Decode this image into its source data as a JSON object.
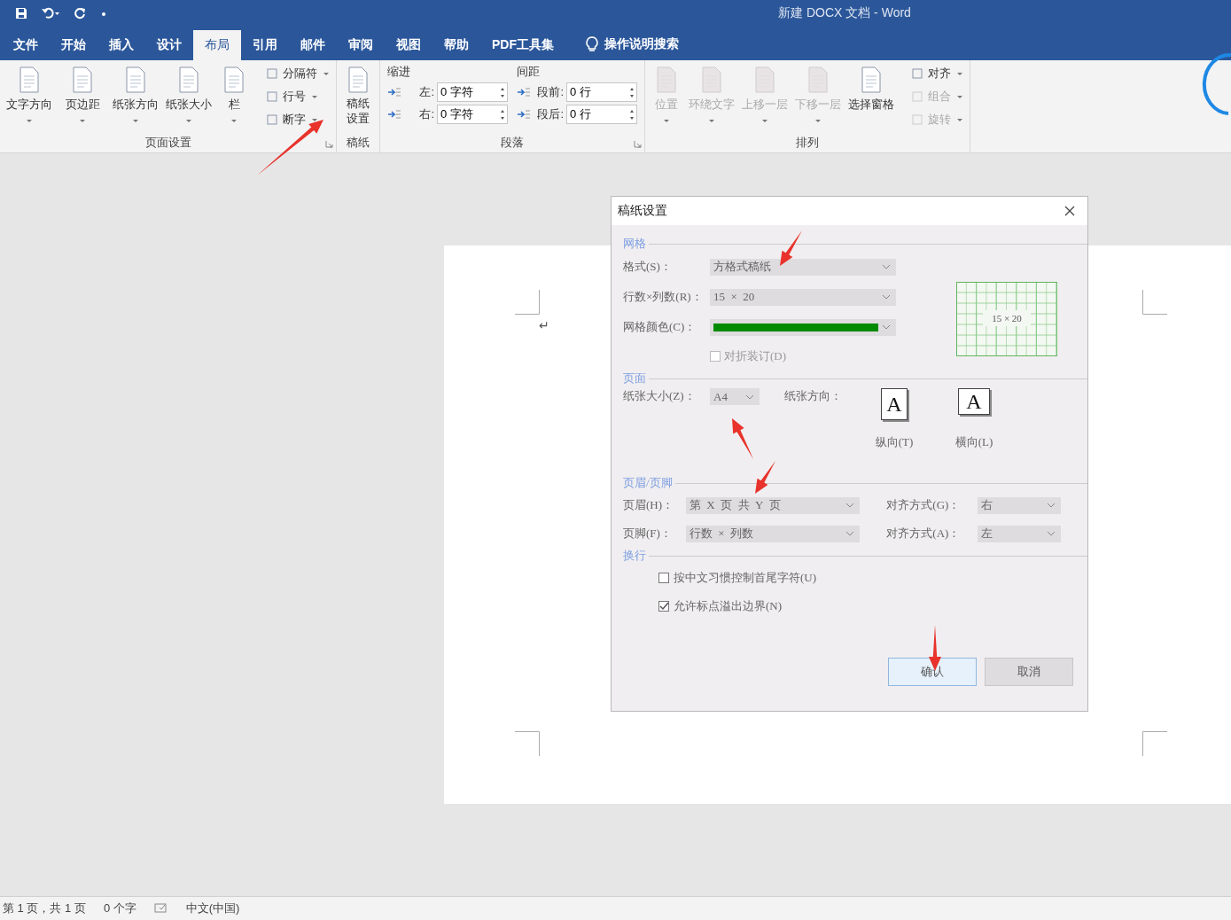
{
  "window": {
    "title": "新建 DOCX 文档  -  Word"
  },
  "tabs": [
    {
      "label": "文件",
      "selected": false
    },
    {
      "label": "开始",
      "selected": false
    },
    {
      "label": "插入",
      "selected": false
    },
    {
      "label": "设计",
      "selected": false
    },
    {
      "label": "布局",
      "selected": true
    },
    {
      "label": "引用",
      "selected": false
    },
    {
      "label": "邮件",
      "selected": false
    },
    {
      "label": "审阅",
      "selected": false
    },
    {
      "label": "视图",
      "selected": false
    },
    {
      "label": "帮助",
      "selected": false
    },
    {
      "label": "PDF工具集",
      "selected": false
    }
  ],
  "tell_me": "操作说明搜索",
  "ribbon": {
    "groups": [
      {
        "kind": "buttons",
        "label": "页面设置",
        "launcher": true,
        "large": [
          {
            "label": "文字方向",
            "dropdown": true,
            "disabled": false
          },
          {
            "label": "页边距",
            "dropdown": true,
            "disabled": false
          },
          {
            "label": "纸张方向",
            "dropdown": true,
            "disabled": false
          },
          {
            "label": "纸张大小",
            "dropdown": true,
            "disabled": false
          },
          {
            "label": "栏",
            "dropdown": true,
            "disabled": false
          }
        ],
        "small": [
          {
            "label": "分隔符",
            "dropdown": true,
            "disabled": false
          },
          {
            "label": "行号",
            "dropdown": true,
            "disabled": false
          },
          {
            "label": "断字",
            "dropdown": true,
            "disabled": false
          }
        ]
      },
      {
        "kind": "buttons",
        "label": "稿纸",
        "launcher": false,
        "large": [
          {
            "label": "稿纸设置",
            "dropdown": false,
            "disabled": false
          }
        ]
      },
      {
        "kind": "paragraph",
        "label": "段落",
        "launcher": true,
        "indent": {
          "title": "缩进",
          "fields": [
            {
              "label": "左:",
              "value": "0 字符"
            },
            {
              "label": "右:",
              "value": "0 字符"
            }
          ]
        },
        "spacing": {
          "title": "间距",
          "fields": [
            {
              "label": "段前:",
              "value": "0 行"
            },
            {
              "label": "段后:",
              "value": "0 行"
            }
          ]
        }
      },
      {
        "kind": "buttons",
        "label": "排列",
        "launcher": false,
        "large": [
          {
            "label": "位置",
            "dropdown": true,
            "disabled": true
          },
          {
            "label": "环绕文字",
            "dropdown": true,
            "disabled": true
          },
          {
            "label": "上移一层",
            "dropdown": true,
            "disabled": true
          },
          {
            "label": "下移一层",
            "dropdown": true,
            "disabled": true
          },
          {
            "label": "选择窗格",
            "dropdown": false,
            "disabled": false
          }
        ],
        "small": [
          {
            "label": "对齐",
            "dropdown": true,
            "disabled": false
          },
          {
            "label": "组合",
            "dropdown": true,
            "disabled": true
          },
          {
            "label": "旋转",
            "dropdown": true,
            "disabled": true
          }
        ]
      }
    ]
  },
  "document": {
    "paragraph_mark": "↵"
  },
  "dialog": {
    "title": "稿纸设置",
    "grid": {
      "legend": "网格",
      "format_label": "格式(S)：",
      "format_value": "方格式稿纸",
      "size_label": "行数×列数(R)：",
      "size_value": "15  ×  20",
      "color_label": "网格颜色(C)：",
      "color": "#008a00",
      "fold": {
        "label": "对折装订(D)",
        "checked": false,
        "disabled": true
      },
      "preview_label": "15 × 20"
    },
    "page": {
      "legend": "页面",
      "paper_label": "纸张大小(Z)：",
      "paper_value": "A4",
      "orientation_label": "纸张方向：",
      "orientations": [
        {
          "kind": "portrait",
          "glyph": "A",
          "label": "纵向(T)"
        },
        {
          "kind": "landscape",
          "glyph": "A",
          "label": "横向(L)"
        }
      ]
    },
    "header_footer": {
      "legend": "页眉/页脚",
      "rows": [
        {
          "label": "页眉(H)：",
          "value": "第  X  页  共  Y  页",
          "align_label": "对齐方式(G)：",
          "align_value": "右"
        },
        {
          "label": "页脚(F)：",
          "value": "行数  ×  列数",
          "align_label": "对齐方式(A)：",
          "align_value": "左"
        }
      ]
    },
    "wrap": {
      "legend": "换行",
      "options": [
        {
          "label": "按中文习惯控制首尾字符(U)",
          "checked": false
        },
        {
          "label": "允许标点溢出边界(N)",
          "checked": true
        }
      ]
    },
    "buttons": [
      {
        "label": "确认",
        "focused": true
      },
      {
        "label": "取消",
        "focused": false
      }
    ]
  },
  "status_bar": {
    "page": "第 1 页，共 1 页",
    "words": "0 个字",
    "language": "中文(中国)"
  }
}
